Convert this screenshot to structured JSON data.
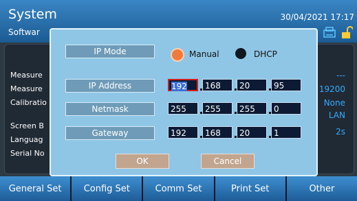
{
  "header": {
    "title": "System",
    "subtitle": "Softwar",
    "datetime": "30/04/2021 17:17"
  },
  "background": {
    "labels": [
      "Measure",
      "Measure",
      "Calibratio",
      "Screen B",
      "Languag",
      "Serial No"
    ],
    "values": [
      "---",
      "19200",
      "None",
      "LAN",
      "2s"
    ]
  },
  "dialog": {
    "ip_mode_label": "IP Mode",
    "ip_mode_options": [
      "Manual",
      "DHCP"
    ],
    "ip_mode_selected": "Manual",
    "ip_address_label": "IP Address",
    "ip_address": [
      "192",
      "168",
      "20",
      "95"
    ],
    "netmask_label": "Netmask",
    "netmask": [
      "255",
      "255",
      "255",
      "0"
    ],
    "gateway_label": "Gateway",
    "gateway": [
      "192",
      "168",
      "20",
      "1"
    ],
    "ok_label": "OK",
    "cancel_label": "Cancel"
  },
  "tabs": [
    "General Set",
    "Config Set",
    "Comm Set",
    "Print Set",
    "Other"
  ],
  "colors": {
    "accent": "#1f5d95",
    "value_blue": "#33aaff",
    "radio_manual": "#f07a3c",
    "radio_dhcp": "#101820"
  }
}
